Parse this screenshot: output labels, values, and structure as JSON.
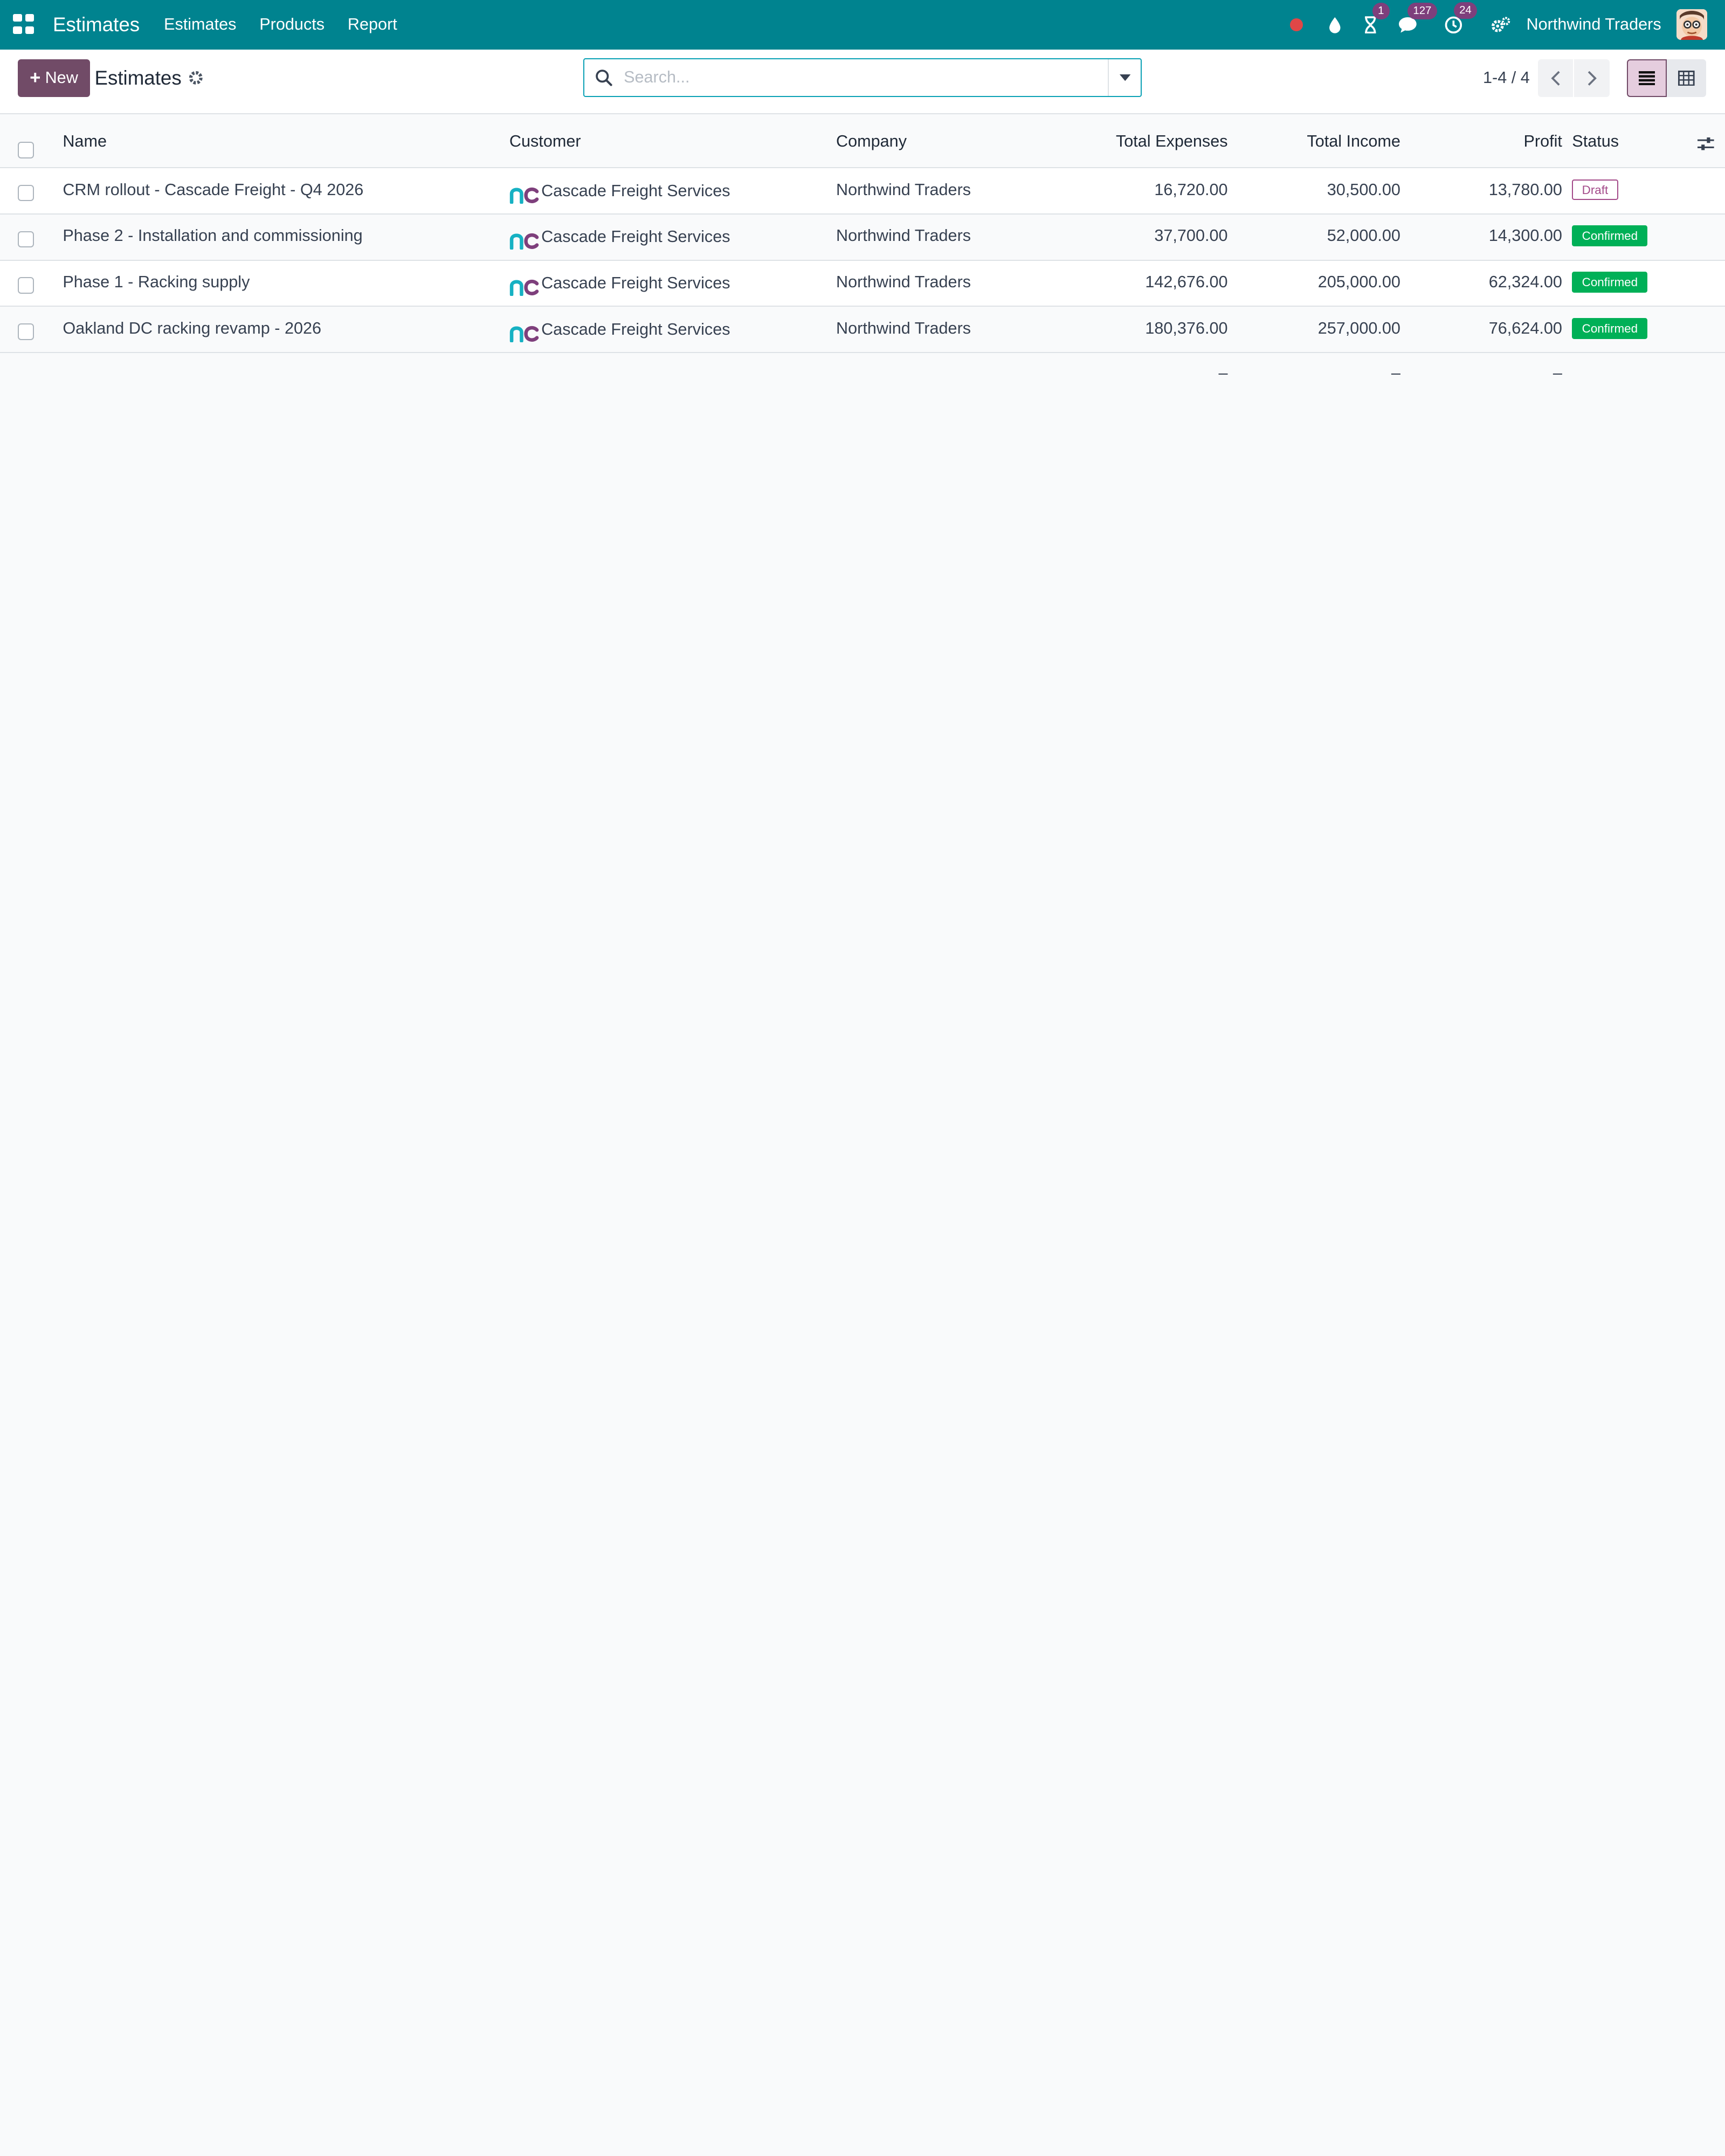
{
  "navbar": {
    "app_title": "Estimates",
    "menus": [
      "Estimates",
      "Products",
      "Report"
    ],
    "badges": {
      "activity": "1",
      "messages": "127",
      "clock": "24"
    },
    "company": "Northwind Traders",
    "colors": {
      "bar": "#00838f",
      "badge": "#7e3f7c"
    }
  },
  "control_panel": {
    "new_label": "New",
    "title": "Estimates",
    "search_placeholder": "Search...",
    "pager": "1-4 / 4"
  },
  "table": {
    "headers": {
      "name": "Name",
      "customer": "Customer",
      "company": "Company",
      "expenses": "Total Expenses",
      "income": "Total Income",
      "profit": "Profit",
      "status": "Status"
    },
    "rows": [
      {
        "name": "CRM rollout - Cascade Freight - Q4 2026",
        "customer": "Cascade Freight Services",
        "company": "Northwind Traders",
        "expenses": "16,720.00",
        "income": "30,500.00",
        "profit": "13,780.00",
        "status": "Draft"
      },
      {
        "name": "Phase 2 - Installation and commissioning",
        "customer": "Cascade Freight Services",
        "company": "Northwind Traders",
        "expenses": "37,700.00",
        "income": "52,000.00",
        "profit": "14,300.00",
        "status": "Confirmed"
      },
      {
        "name": "Phase 1 - Racking supply",
        "customer": "Cascade Freight Services",
        "company": "Northwind Traders",
        "expenses": "142,676.00",
        "income": "205,000.00",
        "profit": "62,324.00",
        "status": "Confirmed"
      },
      {
        "name": "Oakland DC racking revamp - 2026",
        "customer": "Cascade Freight Services",
        "company": "Northwind Traders",
        "expenses": "180,376.00",
        "income": "257,000.00",
        "profit": "76,624.00",
        "status": "Confirmed"
      }
    ],
    "totals": {
      "expenses": "–",
      "income": "–",
      "profit": "–"
    },
    "status_colors": {
      "draft": "#a34a89",
      "confirmed": "#00b057"
    }
  }
}
